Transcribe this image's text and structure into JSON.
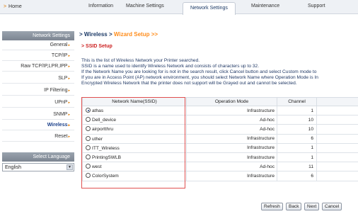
{
  "nav": {
    "home": "Home",
    "tabs": [
      "Information",
      "Machine Settings",
      "Network Settings",
      "Maintenance",
      "Support"
    ]
  },
  "sidebar": {
    "header": "Network Settings",
    "items": [
      {
        "label": "General"
      },
      {
        "label": "TCP/IP"
      },
      {
        "label": "Raw TCP/IP,LPR,IPP"
      },
      {
        "label": "SLP"
      },
      {
        "label": "IP Filtering"
      },
      {
        "label": "UPnP"
      },
      {
        "label": "SNMP"
      },
      {
        "label": "Wireless"
      },
      {
        "label": "Reset"
      }
    ],
    "active": "Wireless",
    "language_header": "Select Language",
    "language_value": "English"
  },
  "main": {
    "breadcrumb": "Wireless",
    "breadcrumb_sub": "Wizard Setup >>",
    "section_title": "SSID Setup",
    "description": [
      "This is the list of Wireless Network your Printer searched.",
      "SSID is a name used to identify Wireless Network and consists of characters up to 32.",
      "If the Network Name you are looking for is not in the search result, click Cancel button and select Custom mode to",
      "If you are in Access Point (AP) network environment, you should select Network Name where Operation Mode is In",
      "Encrypted Wireless Network that the printer does not support will be Grayed out and cannot be selected."
    ],
    "table": {
      "headers": [
        "Network Name(SSID)",
        "Operation Mode",
        "Channel"
      ],
      "rows": [
        {
          "ssid": "athas",
          "mode": "Infrastructure",
          "channel": "1",
          "selected": true
        },
        {
          "ssid": "Dell_device",
          "mode": "Ad-hoc",
          "channel": "10",
          "selected": false
        },
        {
          "ssid": "airportthru",
          "mode": "Ad-hoc",
          "channel": "10",
          "selected": false
        },
        {
          "ssid": "uther",
          "mode": "Infrastructure",
          "channel": "6",
          "selected": false
        },
        {
          "ssid": "ITT_Wireless",
          "mode": "Infrastructure",
          "channel": "1",
          "selected": false
        },
        {
          "ssid": "PrintingSWLB",
          "mode": "Infrastructure",
          "channel": "1",
          "selected": false
        },
        {
          "ssid": "west",
          "mode": "Ad-hoc",
          "channel": "11",
          "selected": false
        },
        {
          "ssid": "ColorSystem",
          "mode": "Infrastructure",
          "channel": "6",
          "selected": false
        }
      ]
    },
    "buttons": {
      "refresh": "Refresh",
      "back": "Back",
      "next": "Next",
      "cancel": "Cancel"
    }
  },
  "colors": {
    "accent_orange": "#e07b00",
    "title_blue": "#1c3a66",
    "section_red": "#cc1f1f",
    "highlight_red": "#e05050"
  }
}
